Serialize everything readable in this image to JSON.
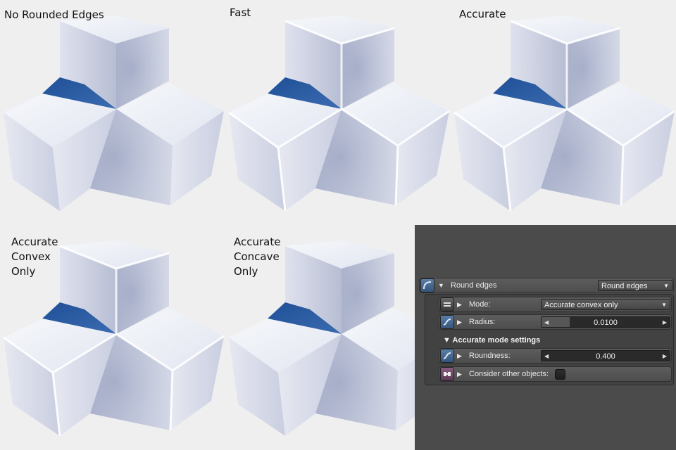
{
  "renders": [
    {
      "caption": "No Rounded Edges"
    },
    {
      "caption": "Fast"
    },
    {
      "caption": "Accurate"
    },
    {
      "caption": "Accurate\nConvex\nOnly"
    },
    {
      "caption": "Accurate\nConcave\nOnly"
    }
  ],
  "panel": {
    "round_edges": {
      "label": "Round edges",
      "dropdown_value": "Round edges"
    },
    "mode": {
      "label": "Mode:",
      "value": "Accurate convex only"
    },
    "radius": {
      "label": "Radius:",
      "value": "0.0100",
      "fill_fraction": 0.22
    },
    "section_title": "Accurate mode settings",
    "roundness": {
      "label": "Roundness:",
      "value": "0.400",
      "fill_fraction": 0.0
    },
    "consider_other_objects": {
      "label": "Consider other objects:",
      "checked": false
    }
  },
  "icons": {
    "expand": "triangle-down",
    "collapse": "triangle-right",
    "slider_left": "triangle-left",
    "slider_right": "triangle-right"
  }
}
